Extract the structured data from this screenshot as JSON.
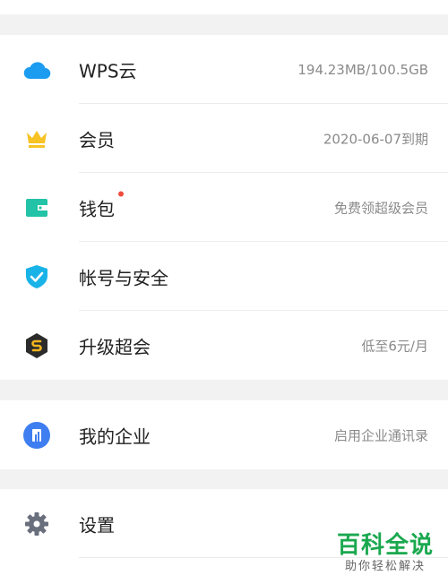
{
  "group1": {
    "items": [
      {
        "icon": "cloud-icon",
        "label": "WPS云",
        "value": "194.23MB/100.5GB"
      },
      {
        "icon": "crown-icon",
        "label": "会员",
        "value": "2020-06-07到期"
      },
      {
        "icon": "wallet-icon",
        "label": "钱包",
        "value": "免费领超级会员",
        "badge": true
      },
      {
        "icon": "shield-check-icon",
        "label": "帐号与安全",
        "value": ""
      },
      {
        "icon": "dollar-hex-icon",
        "label": "升级超会",
        "value": "低至6元/月"
      }
    ]
  },
  "group2": {
    "items": [
      {
        "icon": "enterprise-icon",
        "label": "我的企业",
        "value": "启用企业通讯录"
      }
    ]
  },
  "group3": {
    "items": [
      {
        "icon": "gear-icon",
        "label": "设置",
        "value": ""
      }
    ]
  },
  "watermark": {
    "title": "百科全说",
    "subtitle": "助你轻松解决"
  },
  "colors": {
    "cloud": "#1b9cf0",
    "crown": "#f7c325",
    "wallet": "#22c3a6",
    "shield": "#1ab3e8",
    "dollar_hex": "#2b2b2b",
    "dollar": "#f7b51d",
    "enterprise": "#3f7ef0",
    "gear": "#6a6f7d",
    "badge": "#f04b3e",
    "watermark": "#1aa84f"
  }
}
